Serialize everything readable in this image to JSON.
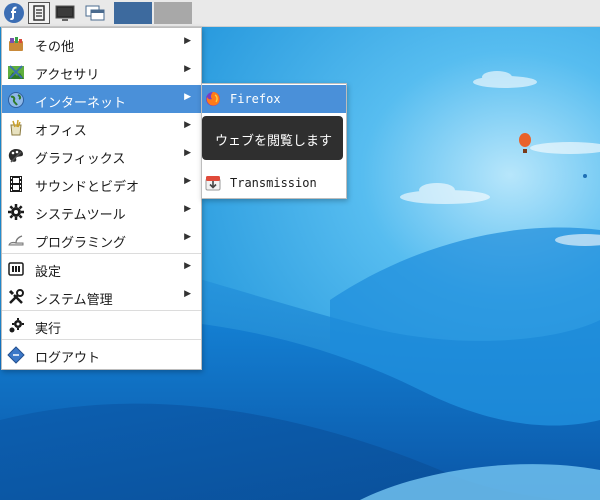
{
  "panel": {
    "launcher_icon": "fedora-logo-icon",
    "buttons": [
      "fedora-menu-button",
      "window-list-button",
      "show-desktop-button",
      "window-switcher-button"
    ],
    "workspaces": [
      "workspace-1",
      "workspace-2"
    ]
  },
  "menu": {
    "items": [
      {
        "label": "その他",
        "icon": "other-apps-icon",
        "has_submenu": true
      },
      {
        "label": "アクセサリ",
        "icon": "accessories-icon",
        "has_submenu": true
      },
      {
        "label": "インターネット",
        "icon": "internet-globe-icon",
        "has_submenu": true,
        "highlighted": true
      },
      {
        "label": "オフィス",
        "icon": "office-icon",
        "has_submenu": true
      },
      {
        "label": "グラフィックス",
        "icon": "graphics-palette-icon",
        "has_submenu": true
      },
      {
        "label": "サウンドとビデオ",
        "icon": "film-strip-icon",
        "has_submenu": true
      },
      {
        "label": "システムツール",
        "icon": "gear-icon",
        "has_submenu": true
      },
      {
        "label": "プログラミング",
        "icon": "programming-icon",
        "has_submenu": true
      },
      {
        "label": "設定",
        "icon": "settings-icon",
        "has_submenu": true
      },
      {
        "label": "システム管理",
        "icon": "tools-icon",
        "has_submenu": true
      },
      {
        "label": "実行",
        "icon": "run-gear-icon",
        "has_submenu": false
      },
      {
        "label": "ログアウト",
        "icon": "logout-icon",
        "has_submenu": false
      }
    ],
    "arrow": "▶"
  },
  "submenu": {
    "items": [
      {
        "label": "Firefox",
        "icon": "firefox-icon",
        "highlighted": true
      },
      {
        "label": "Transmission",
        "icon": "transmission-icon",
        "highlighted": false
      }
    ]
  },
  "tooltip": {
    "text": "ウェブを閲覧します"
  },
  "colors": {
    "highlight": "#4a90d9",
    "panel": "#e9e9e9",
    "sky_top": "#1a9ce0",
    "sky_light": "#8ad0f5",
    "hill_dark": "#0b5fae",
    "tooltip_bg": "#2f2f2f"
  }
}
